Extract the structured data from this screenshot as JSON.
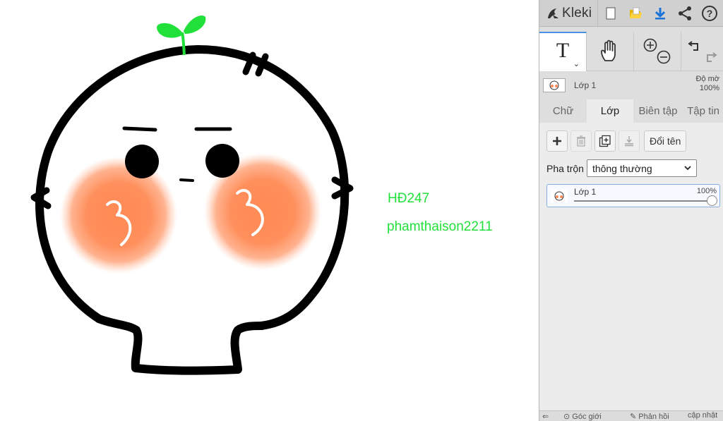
{
  "canvas": {
    "texts": [
      "HĐ247",
      "phamthaison2211"
    ],
    "text_color": "#22e03a",
    "cheek_color": "#ff8a55",
    "sprout_color": "#22e03a"
  },
  "app": {
    "name": "Kleki",
    "accent": "#4a90e2"
  },
  "topbar": {
    "icons": [
      "new-image-icon",
      "open-folder-icon",
      "download-icon",
      "share-icon",
      "help-icon"
    ]
  },
  "toolbar": {
    "active_tool": "text-tool",
    "tools": [
      "text-tool",
      "hand-tool",
      "zoom-in-icon",
      "zoom-out-icon",
      "undo-icon",
      "redo-icon"
    ],
    "text_tool_glyph": "T"
  },
  "layer_info": {
    "name": "Lớp 1",
    "opacity_label": "Độ mờ",
    "opacity_value": "100%"
  },
  "tabs": [
    {
      "label": "Chữ",
      "active": false
    },
    {
      "label": "Lớp",
      "active": true
    },
    {
      "label": "Biên tập",
      "active": false
    },
    {
      "label": "Tập tin",
      "active": false
    }
  ],
  "layers_panel": {
    "rename_label": "Đổi tên",
    "blend_label": "Pha trộn",
    "blend_value": "thông thường",
    "layer_item": {
      "name": "Lớp 1",
      "opacity": "100%",
      "opacity_fraction": 1.0
    }
  },
  "bottombar": {
    "items": [
      "Góc giới",
      "Phản hồi",
      "cập nhật"
    ]
  }
}
